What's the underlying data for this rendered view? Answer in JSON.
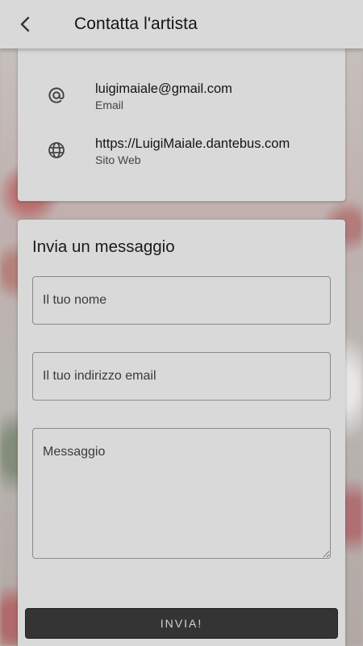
{
  "header": {
    "title": "Contatta l'artista",
    "back_icon": "chevron-left-icon"
  },
  "contacts": {
    "email": {
      "value": "luigimaiale@gmail.com",
      "label": "Email",
      "icon": "at-sign-icon"
    },
    "website": {
      "value": "https://LuigiMaiale.dantebus.com",
      "label": "Sito Web",
      "icon": "globe-icon"
    }
  },
  "form": {
    "title": "Invia un messaggio",
    "name_placeholder": "Il tuo nome",
    "email_placeholder": "Il tuo indirizzo email",
    "message_placeholder": "Messaggio",
    "submit_label": "INVIA!"
  },
  "colors": {
    "card_bg": "#d9d9d9",
    "button_bg": "#343434",
    "button_text": "#d4d4d4"
  }
}
